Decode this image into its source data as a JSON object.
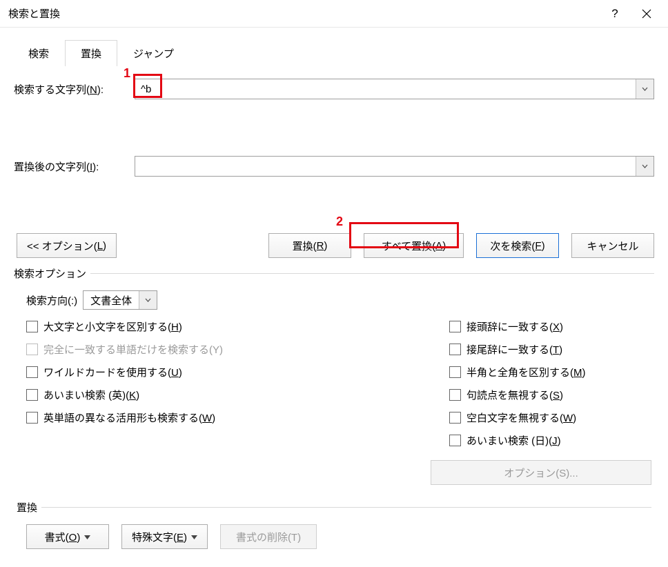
{
  "title": "検索と置換",
  "tabs": {
    "search": "検索",
    "replace": "置換",
    "jump": "ジャンプ"
  },
  "fields": {
    "find_label_pre": "検索する文字列(",
    "find_label_key": "N",
    "find_label_post": "):",
    "find_value": "^b",
    "replace_label_pre": "置換後の文字列(",
    "replace_label_key": "I",
    "replace_label_post": "):",
    "replace_value": ""
  },
  "buttons": {
    "options_less_pre": "<< オプション(",
    "options_less_key": "L",
    "options_less_post": ")",
    "replace_pre": "置換(",
    "replace_key": "R",
    "replace_post": ")",
    "replace_all_pre": "すべて置換(",
    "replace_all_key": "A",
    "replace_all_post": ")",
    "find_next_pre": "次を検索(",
    "find_next_key": "F",
    "find_next_post": ")",
    "cancel": "キャンセル",
    "options_s": "オプション(S)...",
    "format_pre": "書式(",
    "format_key": "O",
    "format_post": ")",
    "special_pre": "特殊文字(",
    "special_key": "E",
    "special_post": ")",
    "noformat": "書式の削除(T)"
  },
  "search_options": {
    "legend": "検索オプション",
    "direction_label": "検索方向(:)",
    "direction_value": "文書全体",
    "left": {
      "match_case_pre": "大文字と小文字を区別する(",
      "match_case_key": "H",
      "match_case_post": ")",
      "whole_word": "完全に一致する単語だけを検索する(Y)",
      "wildcards_pre": "ワイルドカードを使用する(",
      "wildcards_key": "U",
      "wildcards_post": ")",
      "sounds_like_en_pre": "あいまい検索 (英)(",
      "sounds_like_en_key": "K",
      "sounds_like_en_post": ")",
      "all_forms_pre": "英単語の異なる活用形も検索する(",
      "all_forms_key": "W",
      "all_forms_post": ")"
    },
    "right": {
      "prefix_pre": "接頭辞に一致する(",
      "prefix_key": "X",
      "prefix_post": ")",
      "suffix_pre": "接尾辞に一致する(",
      "suffix_key": "T",
      "suffix_post": ")",
      "width_pre": "半角と全角を区別する(",
      "width_key": "M",
      "width_post": ")",
      "punct_pre": "句読点を無視する(",
      "punct_key": "S",
      "punct_post": ")",
      "whitespace_pre": "空白文字を無視する(",
      "whitespace_key": "W",
      "whitespace_post": ")",
      "sounds_like_ja_pre": "あいまい検索 (日)(",
      "sounds_like_ja_key": "J",
      "sounds_like_ja_post": ")"
    }
  },
  "replace_section": {
    "legend": "置換"
  },
  "annotations": {
    "one": "1",
    "two": "2"
  }
}
